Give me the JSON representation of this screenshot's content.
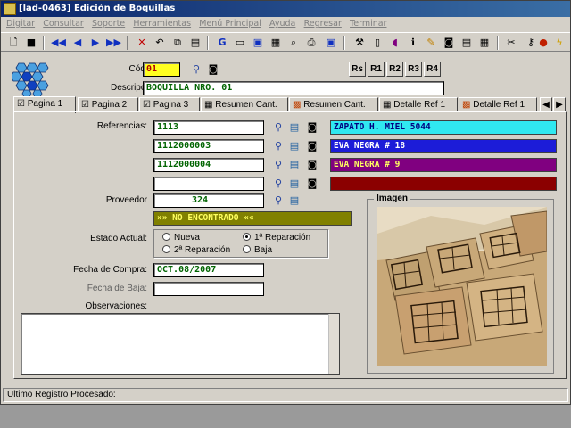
{
  "window": {
    "title": "[lad-0463]   Edición de Boquillas"
  },
  "menu": [
    "Digitar",
    "Consultar",
    "Soporte",
    "Herramientas",
    "Menú Principal",
    "Ayuda",
    "Regresar",
    "Terminar"
  ],
  "nav_buttons": [
    "Rs",
    "R1",
    "R2",
    "R3",
    "R4"
  ],
  "form": {
    "codigo_label": "Código:",
    "codigo_value": "01",
    "descripcion_label": "Descripción:",
    "descripcion_value": "BOQUILLA NRO. 01",
    "referencias_label": "Referencias:",
    "referencias": [
      {
        "code": "1113",
        "desc": "ZAPATO H. MIEL 5044",
        "color": "#30e8f0",
        "text_color": "#000080"
      },
      {
        "code": "1112000003",
        "desc": "EVA NEGRA # 18",
        "color": "#1c1cd8",
        "text_color": "#ffffff"
      },
      {
        "code": "1112000004",
        "desc": "EVA NEGRA # 9",
        "color": "#800080",
        "text_color": "#ffff60"
      },
      {
        "code": "",
        "desc": "",
        "color": "#8b0000",
        "text_color": "#ffffff"
      }
    ],
    "proveedor_label": "Proveedor",
    "proveedor_code": "324",
    "proveedor_status": "»» NO ENCONTRADO ««",
    "estado_label": "Estado Actual:",
    "estado_options": [
      "Nueva",
      "1ª Reparación",
      "2ª Reparación",
      "Baja"
    ],
    "estado_selected": "1ª Reparación",
    "fecha_compra_label": "Fecha de Compra:",
    "fecha_compra_value": "OCT.08/2007",
    "fecha_baja_label": "Fecha de Baja:",
    "fecha_baja_value": "",
    "observaciones_label": "Observaciones:",
    "imagen_label": "Imagen"
  },
  "tabs": [
    {
      "label": "Pagina 1",
      "icon": "checkbox-icon"
    },
    {
      "label": "Pagina 2",
      "icon": "checkbox-icon"
    },
    {
      "label": "Pagina 3",
      "icon": "checkbox-icon"
    },
    {
      "label": "Resumen Cant.",
      "icon": "table-icon"
    },
    {
      "label": "Resumen Cant.",
      "icon": "colorful-icon"
    },
    {
      "label": "Detalle Ref 1",
      "icon": "table-icon"
    },
    {
      "label": "Detalle Ref 1",
      "icon": "colorful-icon"
    }
  ],
  "status": {
    "text": "Ultimo Registro Procesado:"
  },
  "colors": {
    "title_start": "#0a246a",
    "title_end": "#3a6ea5",
    "window_bg": "#d4d0c8",
    "code_bg": "#ffff20",
    "prov_status_bg": "#808000"
  }
}
